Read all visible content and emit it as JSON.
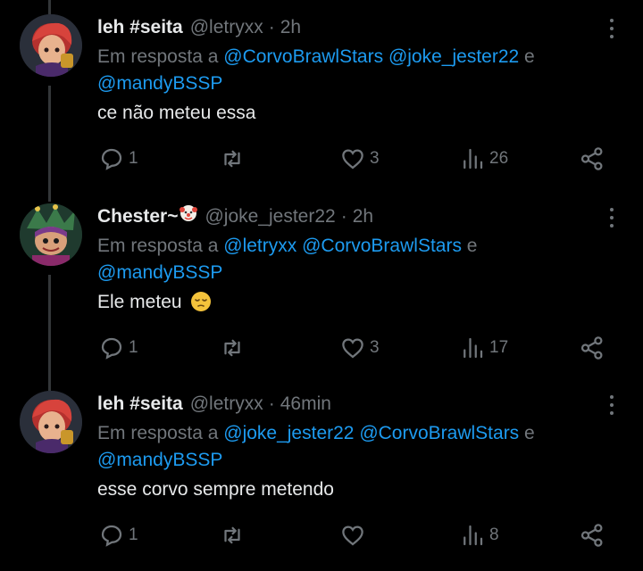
{
  "colors": {
    "background": "#000000",
    "text": "#e7e9ea",
    "muted": "#71767b",
    "link": "#1d9bf0",
    "thread_line": "#333639"
  },
  "tweets": [
    {
      "name": "leh #seita",
      "handle": "@letryxx",
      "separator": "·",
      "time": "2h",
      "reply_prefix": "Em resposta a",
      "mentions": [
        "@CorvoBrawlStars",
        "@joke_jester22"
      ],
      "conjunction": "e",
      "last_mention": "@mandyBSSP",
      "text": "ce não meteu essa",
      "avatar_icon": "brawler-avatar-red-hair",
      "actions": {
        "replies": "1",
        "retweets": "",
        "likes": "3",
        "views": "26"
      }
    },
    {
      "name": "Chester~",
      "name_emoji": "clown-face-emoji",
      "handle": "@joke_jester22",
      "separator": "·",
      "time": "2h",
      "reply_prefix": "Em resposta a",
      "mentions": [
        "@letryxx",
        "@CorvoBrawlStars"
      ],
      "conjunction": "e",
      "last_mention": "@mandyBSSP",
      "text": "Ele meteu",
      "text_emoji": "pensive-face-emoji",
      "avatar_icon": "chester-jester-avatar",
      "actions": {
        "replies": "1",
        "retweets": "",
        "likes": "3",
        "views": "17"
      }
    },
    {
      "name": "leh #seita",
      "handle": "@letryxx",
      "separator": "·",
      "time": "46min",
      "reply_prefix": "Em resposta a",
      "mentions": [
        "@joke_jester22",
        "@CorvoBrawlStars"
      ],
      "conjunction": "e",
      "last_mention": "@mandyBSSP",
      "text": "esse corvo sempre metendo",
      "avatar_icon": "brawler-avatar-red-hair",
      "actions": {
        "replies": "1",
        "retweets": "",
        "likes": "",
        "views": "8"
      }
    }
  ]
}
